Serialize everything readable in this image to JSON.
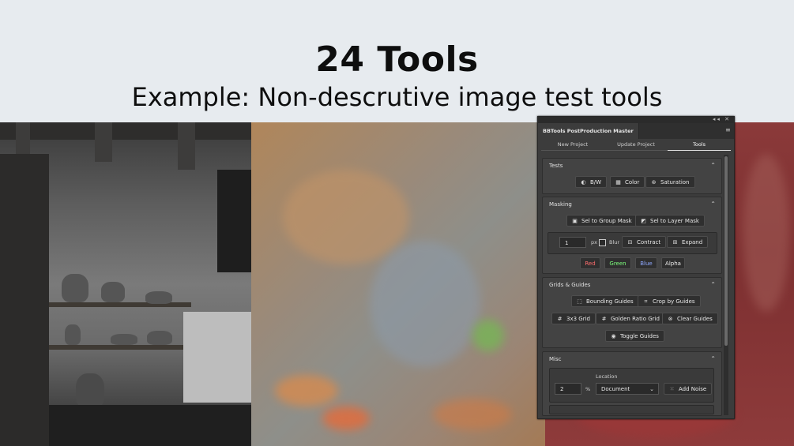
{
  "slide": {
    "title": "24 Tools",
    "subtitle": "Example: Non-descrutive image test tools"
  },
  "panel": {
    "window_controls": "◂◂ ✕",
    "panel_title": "BBTools PostProduction Master",
    "menu_icon": "hamburger-icon",
    "tabs": [
      {
        "label": "New Project",
        "active": false
      },
      {
        "label": "Update Project",
        "active": false
      },
      {
        "label": "Tools",
        "active": true
      }
    ],
    "sections": {
      "tests": {
        "title": "Tests",
        "buttons": [
          {
            "label": "B/W",
            "icon": "contrast-icon"
          },
          {
            "label": "Color",
            "icon": "color-grid-icon"
          },
          {
            "label": "Saturation",
            "icon": "saturation-icon"
          }
        ]
      },
      "masking": {
        "title": "Masking",
        "buttons": [
          {
            "label": "Sel to Group Mask",
            "icon": "group-mask-icon"
          },
          {
            "label": "Sel to Layer Mask",
            "icon": "layer-mask-icon"
          }
        ],
        "px_value": "1",
        "px_label": "px",
        "blur_label": "Blur",
        "contract_label": "Contract",
        "expand_label": "Expand",
        "channels": [
          {
            "label": "Red",
            "color": "#ff6e6e"
          },
          {
            "label": "Green",
            "color": "#7dff7d"
          },
          {
            "label": "Blue",
            "color": "#8fa8ff"
          },
          {
            "label": "Alpha",
            "color": "#eeeeee"
          }
        ]
      },
      "grids": {
        "title": "Grids & Guides",
        "buttons": [
          {
            "label": "Bounding Guides",
            "icon": "bounding-box-icon"
          },
          {
            "label": "Crop by Guides",
            "icon": "crop-icon"
          },
          {
            "label": "3x3 Grid",
            "icon": "grid-icon"
          },
          {
            "label": "Golden Ratio Grid",
            "icon": "golden-grid-icon"
          },
          {
            "label": "Clear Guides",
            "icon": "clear-icon"
          },
          {
            "label": "Toggle Guides",
            "icon": "eye-icon"
          }
        ]
      },
      "misc": {
        "title": "Misc",
        "location_label": "Location",
        "noise_value": "2",
        "percent_label": "%",
        "location_value": "Document",
        "add_noise_label": "Add Noise",
        "add_noise_icon": "noise-icon"
      }
    }
  }
}
